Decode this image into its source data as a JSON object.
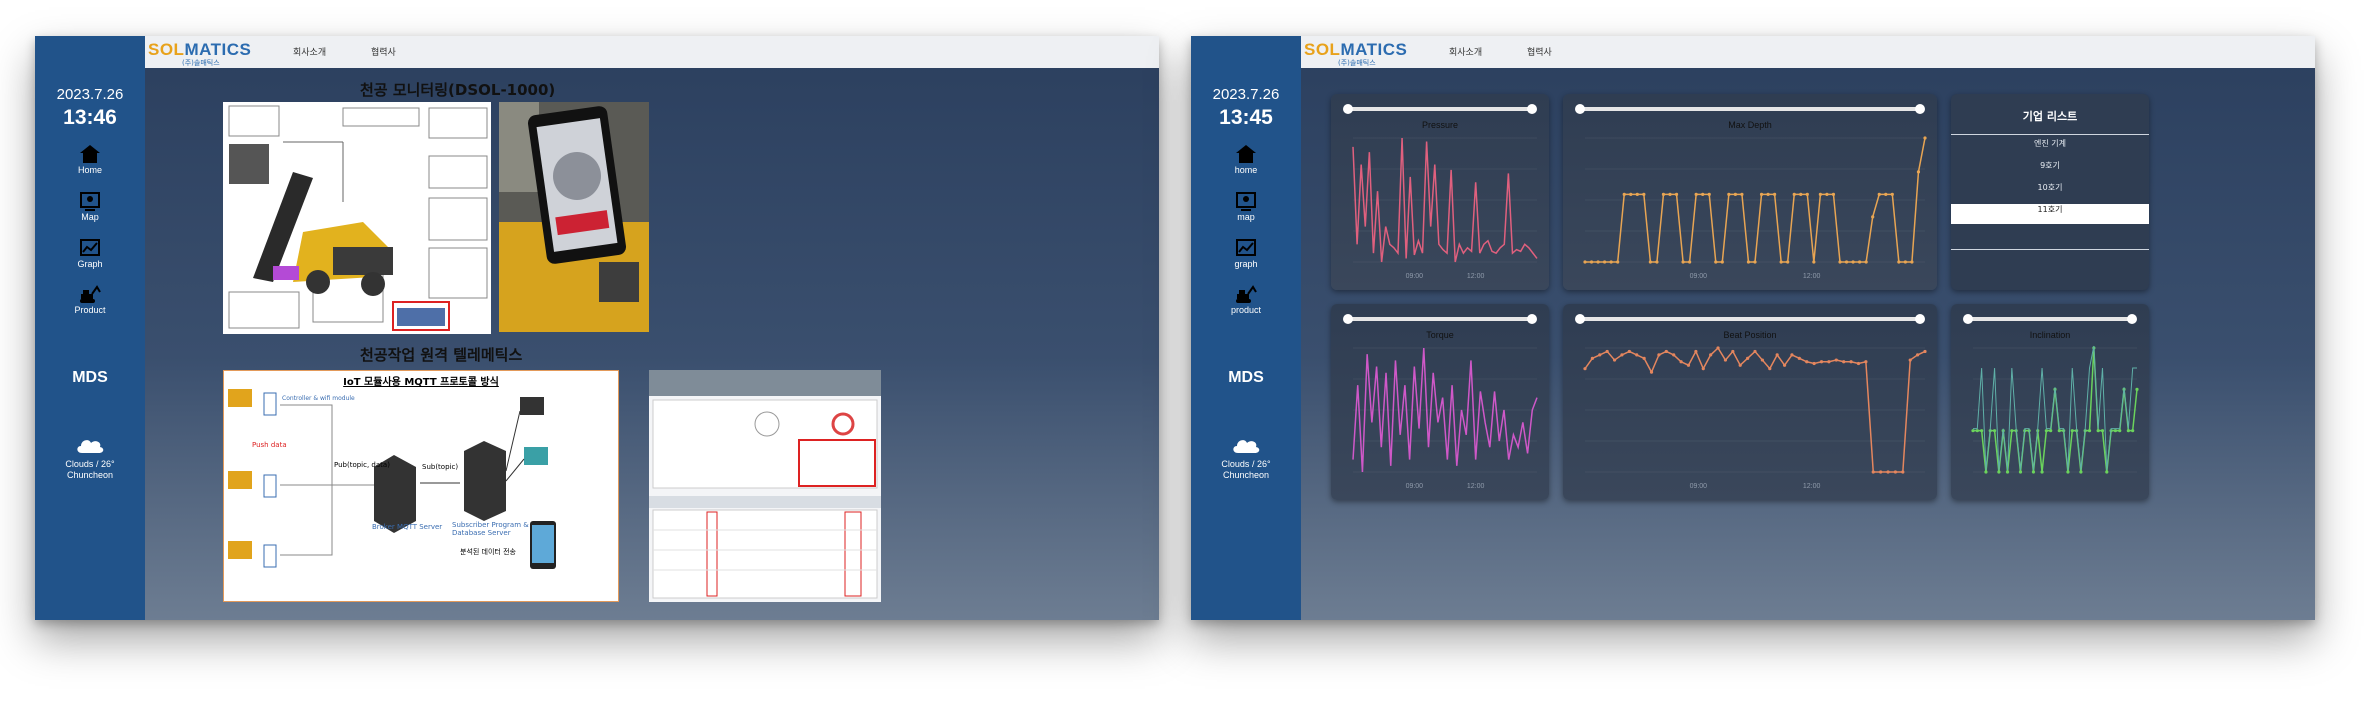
{
  "brand": {
    "logo_a": "SOL",
    "logo_b": "MATICS",
    "logo_sub": "(주)솔매틱스"
  },
  "nav": {
    "about": "회사소개",
    "partners": "협력사"
  },
  "left_screen": {
    "date": "2023.7.26",
    "time": "13:46",
    "sidebar": [
      {
        "label": "Home",
        "icon": "home-icon"
      },
      {
        "label": "Map",
        "icon": "map-icon"
      },
      {
        "label": "Graph",
        "icon": "graph-icon"
      },
      {
        "label": "Product",
        "icon": "excavator-icon"
      }
    ],
    "mds": "MDS",
    "weather": {
      "text": "Clouds / 26°",
      "city": "Chuncheon",
      "icon": "cloud-icon"
    },
    "title_1": "천공 모니터링(DSOL-1000)",
    "title_2": "천공작업 원격 텔레메틱스",
    "mqtt_title": "IoT 모듈사용 MQTT 프로토콜 방식",
    "mqtt_broker": "Broker MQTT Server",
    "mqtt_subscriber": "Subscriber Program & Database Server",
    "mqtt_publish": "Pub(topic, data)",
    "mqtt_subscribe": "Sub(topic)",
    "mqtt_push": "Push data",
    "mqtt_controller": "Controller & wifi module",
    "mqtt_transfer": "분석된 데이터 전송"
  },
  "right_screen": {
    "date": "2023.7.26",
    "time": "13:45",
    "sidebar": [
      {
        "label": "home",
        "icon": "home-icon"
      },
      {
        "label": "map",
        "icon": "map-icon"
      },
      {
        "label": "graph",
        "icon": "graph-icon"
      },
      {
        "label": "product",
        "icon": "excavator-icon"
      }
    ],
    "mds": "MDS",
    "weather": {
      "text": "Clouds / 26°",
      "city": "Chuncheon"
    },
    "company_list": {
      "title": "기업 리스트",
      "items": [
        "엔진 기계",
        "9호기",
        "10호기",
        "11호기"
      ],
      "selected": "11호기"
    }
  },
  "chart_data": [
    {
      "type": "line",
      "title": "Pressure",
      "color": "#e0607e",
      "x": [
        "09:00",
        "12:00"
      ],
      "values": [
        115,
        60,
        105,
        70,
        112,
        55,
        90,
        50,
        70,
        60,
        58,
        55,
        120,
        52,
        98,
        54,
        62,
        55,
        118,
        70,
        105,
        60,
        57,
        55,
        102,
        50,
        60,
        55,
        58,
        56,
        95,
        55,
        60,
        62,
        56,
        55,
        58,
        60,
        100,
        55,
        57,
        56,
        60,
        58,
        55,
        52
      ]
    },
    {
      "type": "line",
      "title": "Max Depth",
      "color": "#e8a553",
      "x": [
        "09:00",
        "12:00"
      ],
      "values": [
        2,
        2,
        2,
        2,
        2,
        2,
        8,
        8,
        8,
        8,
        2,
        2,
        8,
        8,
        8,
        2,
        2,
        8,
        8,
        8,
        2,
        2,
        8,
        8,
        8,
        2,
        2,
        8,
        8,
        8,
        2,
        2,
        8,
        8,
        8,
        2,
        8,
        8,
        8,
        2,
        2,
        2,
        2,
        2,
        6,
        8,
        8,
        8,
        2,
        2,
        2,
        10,
        13
      ]
    },
    {
      "type": "line",
      "title": "Torque",
      "color": "#cf58c8",
      "x": [
        "09:00",
        "12:00"
      ],
      "values": [
        500,
        1100,
        400,
        1350,
        800,
        1250,
        600,
        1200,
        450,
        1300,
        700,
        1100,
        500,
        1250,
        750,
        1400,
        600,
        1200,
        800,
        1000,
        500,
        1100,
        450,
        900,
        700,
        1300,
        500,
        1050,
        800,
        600,
        1050,
        650,
        900,
        500,
        700,
        600,
        800,
        550,
        900,
        1000
      ]
    },
    {
      "type": "line",
      "title": "Beat Position",
      "color": "#e4865e",
      "x": [
        "09:00",
        "12:00"
      ],
      "values": [
        70,
        76,
        78,
        80,
        75,
        78,
        80,
        78,
        76,
        68,
        78,
        80,
        78,
        74,
        72,
        80,
        70,
        78,
        82,
        75,
        80,
        72,
        76,
        80,
        75,
        70,
        78,
        72,
        78,
        76,
        74,
        73,
        74,
        74,
        75,
        74,
        74,
        73,
        74,
        10,
        10,
        10,
        10,
        10,
        75,
        78,
        80
      ]
    },
    {
      "type": "line",
      "title": "Inclination",
      "color": "#6bd35c",
      "series2_color": "#5fb0a8",
      "values": [
        6,
        6,
        6,
        5,
        6,
        6,
        5,
        6,
        5,
        6,
        6,
        5,
        6,
        6,
        5,
        6,
        5,
        6,
        6,
        7,
        6,
        6,
        5,
        6,
        6,
        5,
        6,
        6,
        8,
        6,
        6,
        5,
        6,
        6,
        6,
        7,
        6,
        6,
        7
      ]
    }
  ]
}
